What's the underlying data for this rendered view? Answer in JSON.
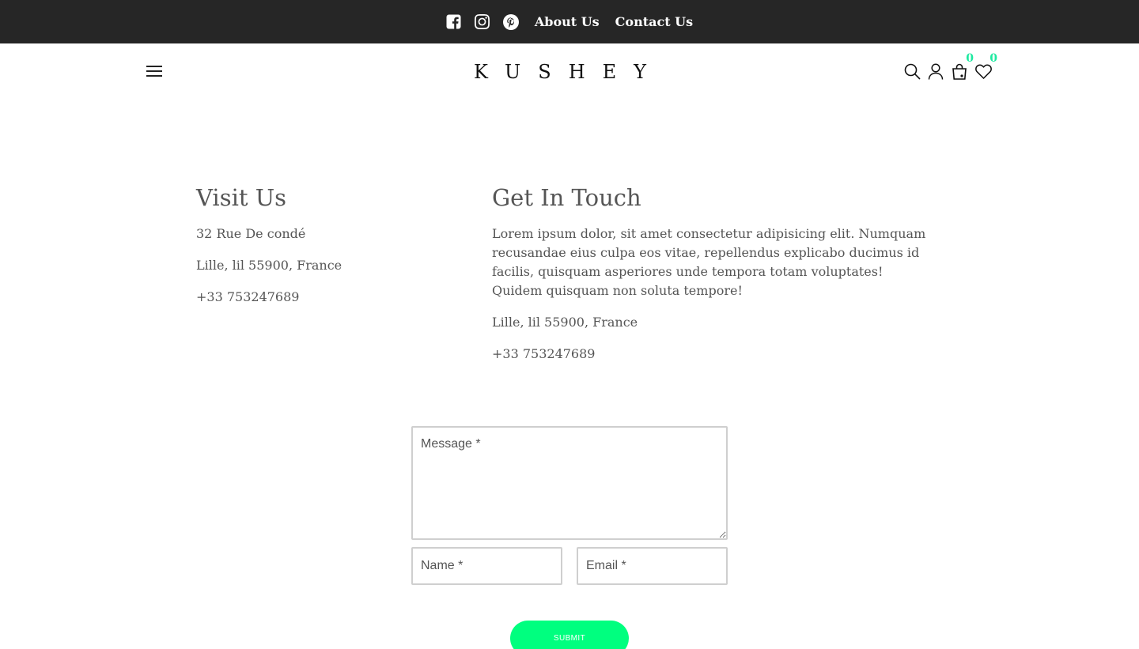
{
  "topbar": {
    "social": [
      {
        "icon": "facebook-square-icon"
      },
      {
        "icon": "instagram-icon"
      },
      {
        "icon": "pinterest-icon"
      }
    ],
    "links": [
      "About Us",
      "Contact Us"
    ]
  },
  "header": {
    "logo": "KUSHEY",
    "cart_count": "0",
    "wishlist_count": "0"
  },
  "visit": {
    "title": "Visit Us",
    "lines": [
      "32 Rue De condé",
      "Lille, lil 55900, France",
      "+33 753247689"
    ]
  },
  "touch": {
    "title": "Get In Touch",
    "description": "Lorem ipsum dolor, sit amet consectetur adipisicing elit. Numquam recusandae eius culpa eos vitae, repellendus explicabo ducimus id facilis, quisquam asperiores unde tempora totam voluptates! Quidem quisquam non soluta tempore!",
    "address": "Lille, lil 55900, France",
    "phone": "+33 753247689"
  },
  "form": {
    "message_placeholder": "Message *",
    "name_placeholder": "Name *",
    "email_placeholder": "Email *",
    "submit_label": "Submit"
  },
  "colors": {
    "topbar_bg": "#262626",
    "accent": "#00ff7f",
    "badge": "#1de9a0"
  }
}
